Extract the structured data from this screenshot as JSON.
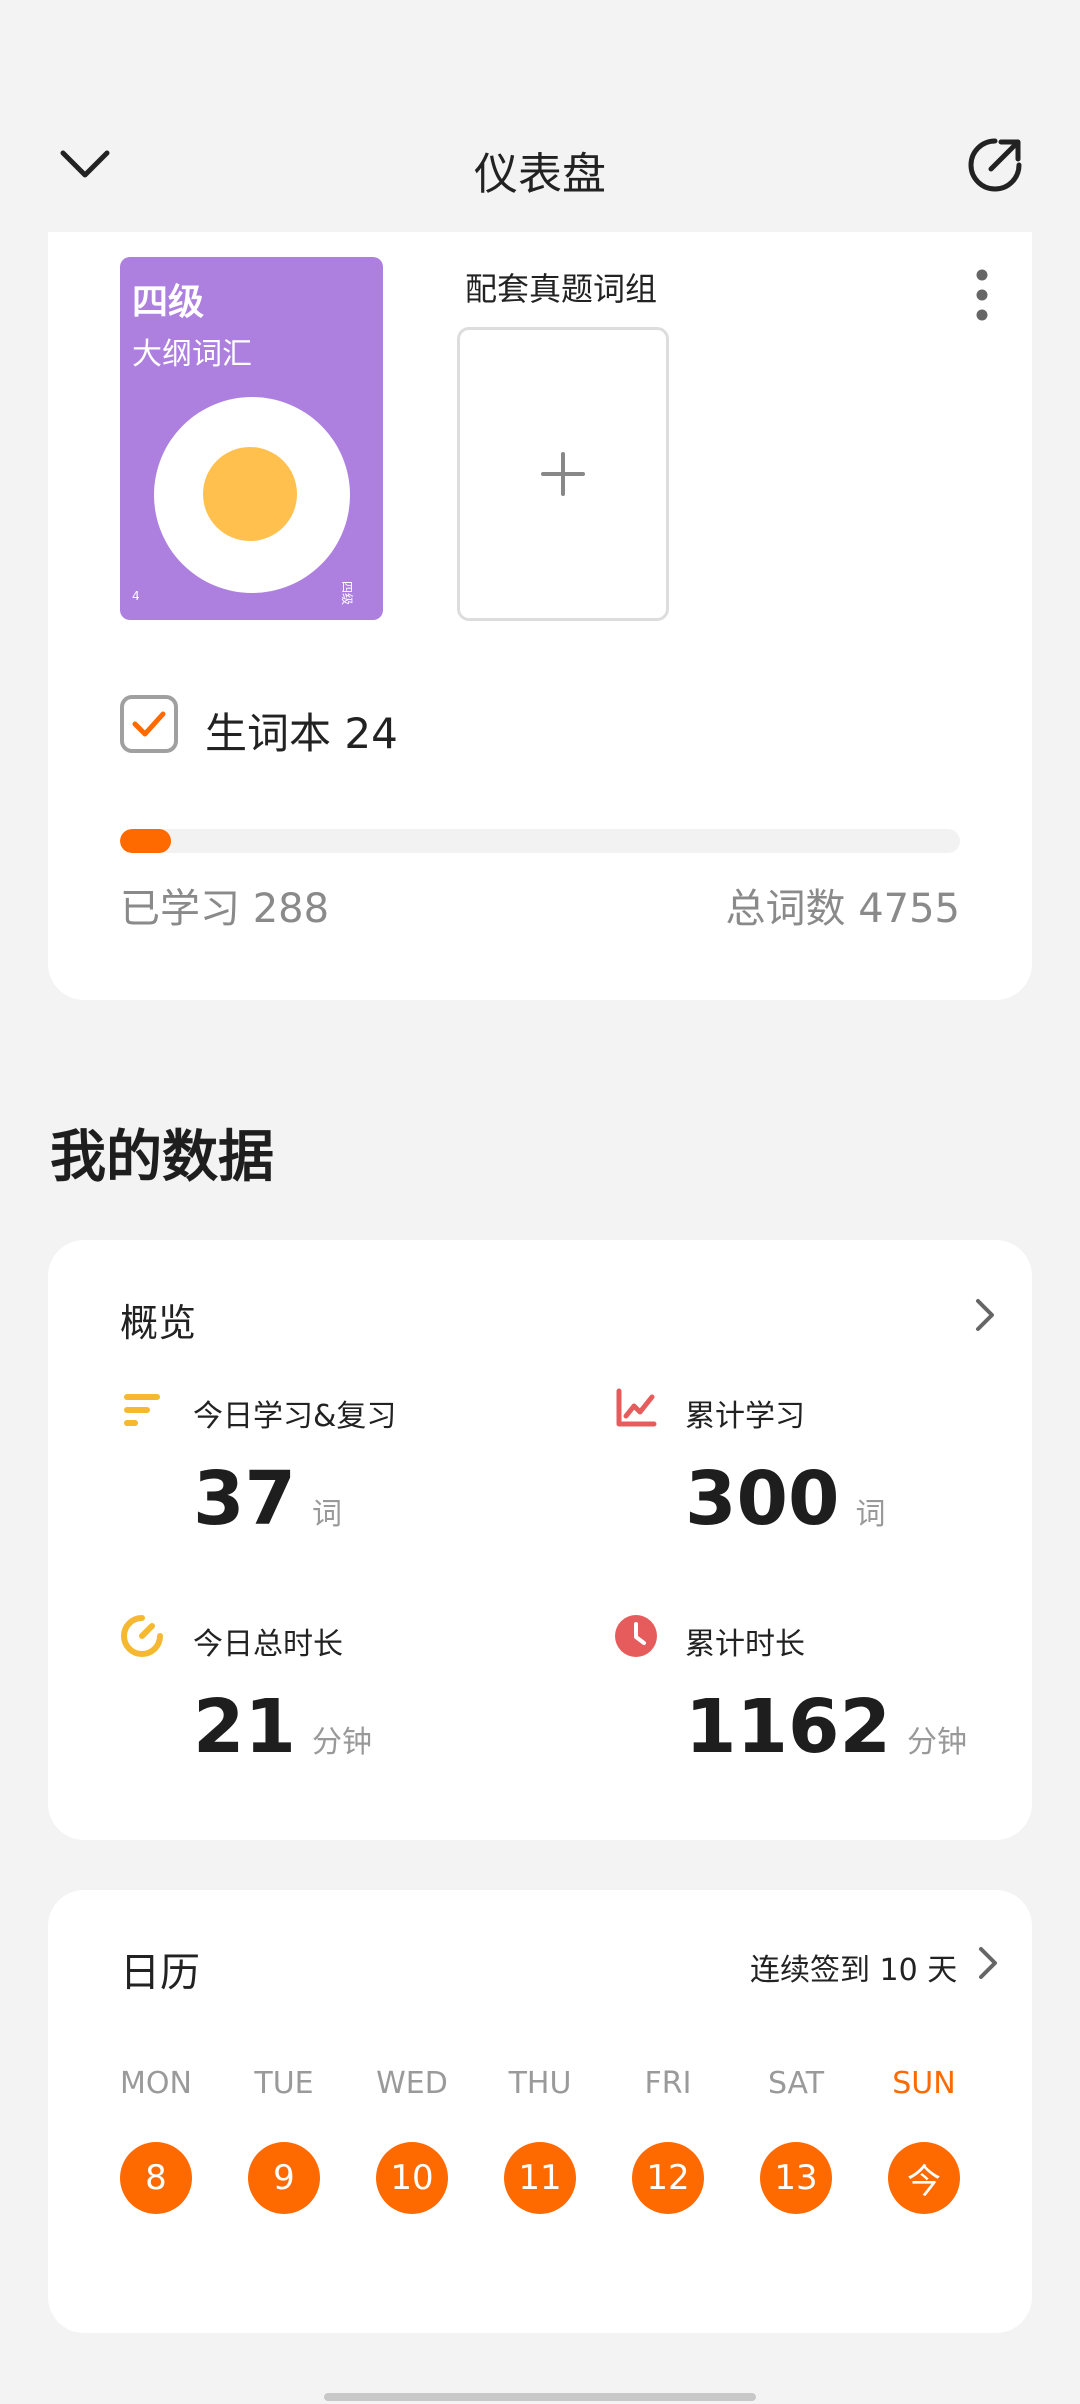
{
  "header": {
    "title": "仪表盘",
    "back_icon": "chevron-down-icon",
    "share_icon": "share-icon"
  },
  "book": {
    "cover_level": "四级",
    "cover_subtitle": "大纲词汇",
    "cover_corner_left": "4",
    "cover_corner_right": "四级",
    "cover_color": "#ad80e0",
    "group_title": "配套真题词组",
    "add_icon": "plus-icon",
    "more_icon": "more-vertical-icon",
    "vocab_label": "生词本 24",
    "vocab_checked": true,
    "progress_fraction": 0.0606,
    "learned_label": "已学习 288",
    "total_label": "总词数 4755",
    "accent_color": "#ff6a00"
  },
  "my_data": {
    "title": "我的数据"
  },
  "overview": {
    "title": "概览",
    "arrow_icon": "chevron-right-icon",
    "stats": [
      {
        "label": "今日学习&复习",
        "value": "37",
        "unit": "词",
        "icon": "bars-icon",
        "color": "#f5b82e"
      },
      {
        "label": "累计学习",
        "value": "300",
        "unit": "词",
        "icon": "line-chart-icon",
        "color": "#e65c5c"
      },
      {
        "label": "今日总时长",
        "value": "21",
        "unit": "分钟",
        "icon": "timer-icon",
        "color": "#f5b82e"
      },
      {
        "label": "累计时长",
        "value": "1162",
        "unit": "分钟",
        "icon": "clock-icon",
        "color": "#e65c5c"
      }
    ]
  },
  "calendar": {
    "title": "日历",
    "streak": "连续签到 10 天",
    "arrow_icon": "chevron-right-icon",
    "weekdays": [
      "MON",
      "TUE",
      "WED",
      "THU",
      "FRI",
      "SAT",
      "SUN"
    ],
    "days": [
      "8",
      "9",
      "10",
      "11",
      "12",
      "13",
      "今"
    ],
    "today_index": 6
  }
}
